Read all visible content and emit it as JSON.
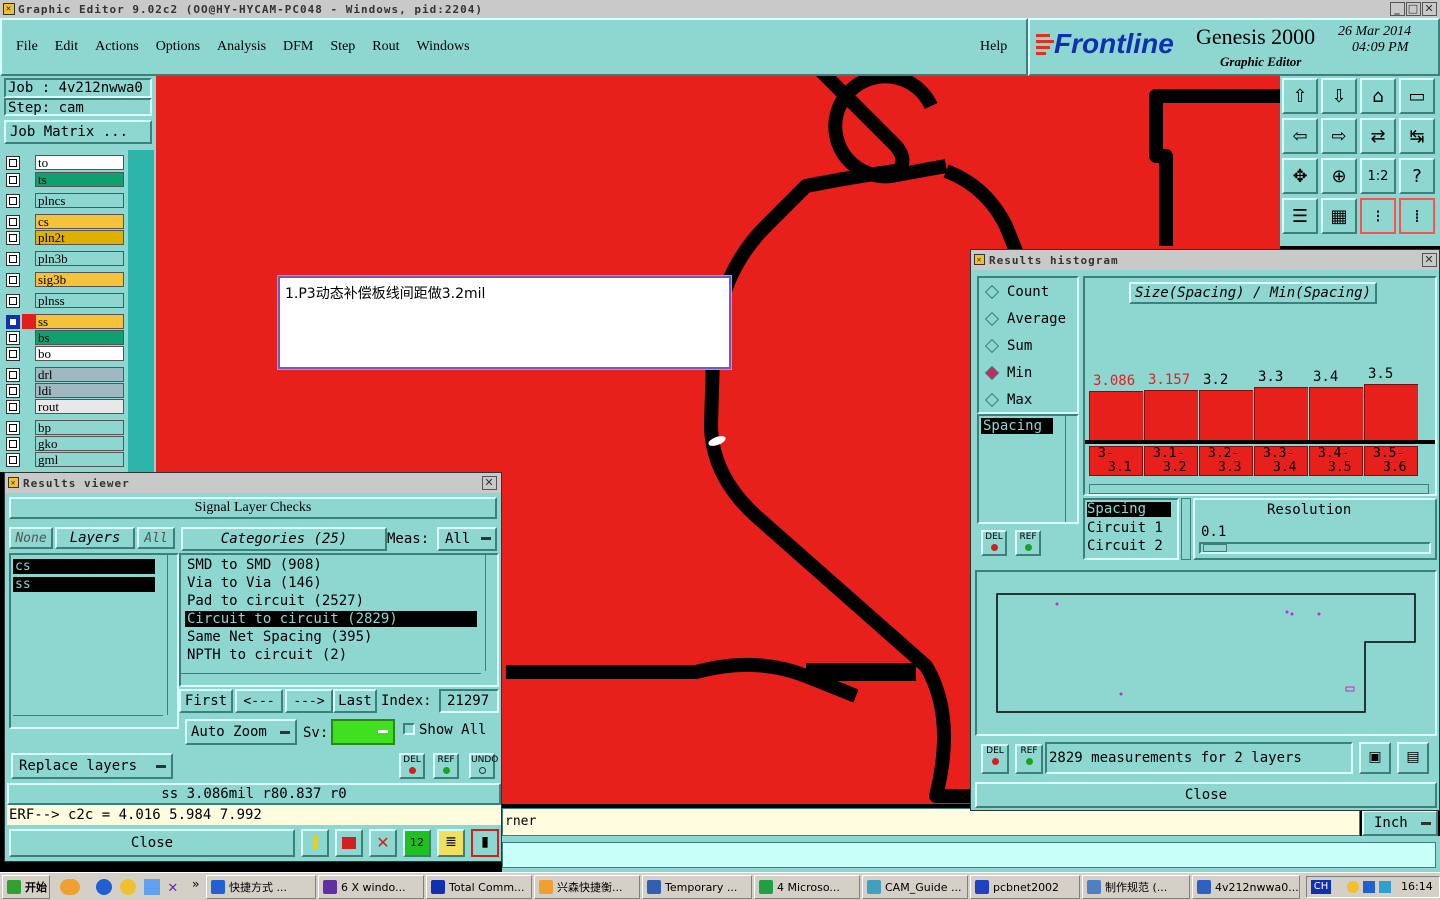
{
  "window_title": "Graphic Editor 9.02c2 (OO@HY-HYCAM-PC048 - Windows, pid:2204)",
  "menu": [
    "File",
    "Edit",
    "Actions",
    "Options",
    "Analysis",
    "DFM",
    "Step",
    "Rout",
    "Windows"
  ],
  "help_label": "Help",
  "brand": {
    "logo": "Frontline",
    "product": "Genesis 2000",
    "subtitle": "Graphic Editor",
    "date": "26 Mar 2014",
    "time": "04:09 PM"
  },
  "job": {
    "job_label": "Job : 4v212nwwa0",
    "step_label": "Step: cam",
    "matrix_button": "Job Matrix ..."
  },
  "layers": [
    {
      "name": "to",
      "color": "#ffffff",
      "checked": false
    },
    {
      "name": "ts",
      "color": "#10a070",
      "checked": false
    },
    {
      "name": "plncs",
      "color": "#8ed6d0",
      "checked": false
    },
    {
      "name": "cs",
      "color": "#f5c23a",
      "checked": false
    },
    {
      "name": "pln2t",
      "color": "#e0b000",
      "checked": false
    },
    {
      "name": "pln3b",
      "color": "#8ed6d0",
      "checked": false
    },
    {
      "name": "sig3b",
      "color": "#f5c23a",
      "checked": false
    },
    {
      "name": "plnss",
      "color": "#8ed6d0",
      "checked": false
    },
    {
      "name": "ss",
      "color": "#f5c23a",
      "checked": true
    },
    {
      "name": "bs",
      "color": "#10a070",
      "checked": false
    },
    {
      "name": "bo",
      "color": "#ffffff",
      "checked": false
    },
    {
      "name": "drl",
      "color": "#a0b8c0",
      "checked": false
    },
    {
      "name": "ldi",
      "color": "#a0b8c0",
      "checked": false
    },
    {
      "name": "rout",
      "color": "#e8e8e8",
      "checked": false
    },
    {
      "name": "bp",
      "color": "#8ed6d0",
      "checked": false
    },
    {
      "name": "gko",
      "color": "#8ed6d0",
      "checked": false
    },
    {
      "name": "gml",
      "color": "#8ed6d0",
      "checked": false
    }
  ],
  "note_text": "1.P3动态补偿板线间距做3.2mil",
  "results_viewer": {
    "title": "Results viewer",
    "header": "Signal Layer Checks",
    "none_label": "None",
    "layers_label": "Layers",
    "all_label": "All",
    "layer_items": [
      "cs",
      "ss"
    ],
    "categories_label": "Categories (25)",
    "meas_label": "Meas:",
    "meas_value": "All",
    "categories": [
      {
        "label": "SMD to SMD (908)",
        "selected": false
      },
      {
        "label": "Via to Via (146)",
        "selected": false
      },
      {
        "label": "Pad to circuit (2527)",
        "selected": false
      },
      {
        "label": "Circuit to circuit (2829)",
        "selected": true
      },
      {
        "label": "Same Net Spacing (395)",
        "selected": false
      },
      {
        "label": "NPTH to circuit (2)",
        "selected": false
      }
    ],
    "first_label": "First",
    "prev_label": "<---",
    "next_label": "--->",
    "last_label": "Last",
    "index_label": "Index:",
    "index_value": "21297",
    "auto_zoom_label": "Auto Zoom",
    "sv_label": "Sv:",
    "show_all_label": "Show All",
    "replace_layers_label": "Replace layers",
    "del_label": "DEL",
    "ref_label": "REF",
    "undo_label": "UNDO",
    "status_line": "ss 3.086mil   r80.837  r0",
    "erf_line": "ERF--> c2c = 4.016 5.984 7.992",
    "close_label": "Close"
  },
  "bottom_bar": {
    "message": "rner",
    "units": "Inch"
  },
  "histogram": {
    "title": "Results histogram",
    "modes": [
      {
        "label": "Count",
        "on": false
      },
      {
        "label": "Average",
        "on": false
      },
      {
        "label": "Sum",
        "on": false
      },
      {
        "label": "Min",
        "on": true
      },
      {
        "label": "Max",
        "on": false
      }
    ],
    "list_item": "Spacing",
    "chart_title": "Size(Spacing) / Min(Spacing)",
    "bins": [
      {
        "value": "3.086",
        "lo": "3-",
        "hi": "3.1",
        "h": 0.7,
        "highlight": true
      },
      {
        "value": "3.157",
        "lo": "3.1-",
        "hi": "3.2",
        "h": 0.72,
        "highlight": true
      },
      {
        "value": "3.2",
        "lo": "3.2-",
        "hi": "3.3",
        "h": 0.72,
        "highlight": false
      },
      {
        "value": "3.3",
        "lo": "3.3-",
        "hi": "3.4",
        "h": 0.76,
        "highlight": false
      },
      {
        "value": "3.4",
        "lo": "3.4-",
        "hi": "3.5",
        "h": 0.76,
        "highlight": false
      },
      {
        "value": "3.5",
        "lo": "3.5-",
        "hi": "3.6",
        "h": 0.8,
        "highlight": false
      }
    ],
    "sel_items": [
      "Spacing",
      "Circuit 1",
      "Circuit 2"
    ],
    "resolution_label": "Resolution",
    "resolution_value": "0.1",
    "measurements": "2829 measurements for 2 layers",
    "close_label": "Close",
    "del_label": "DEL",
    "ref_label": "REF"
  },
  "taskbar": {
    "start": "开始",
    "items": [
      "快捷方式 ...",
      "6 X windo...",
      "Total Comm...",
      "兴森快捷衡...",
      "Temporary ...",
      "4 Microso...",
      "CAM_Guide ...",
      "pcbnet2002",
      "制作规范 (...",
      "4v212nwwa0..."
    ],
    "lang": "CH",
    "clock": "16:14"
  }
}
